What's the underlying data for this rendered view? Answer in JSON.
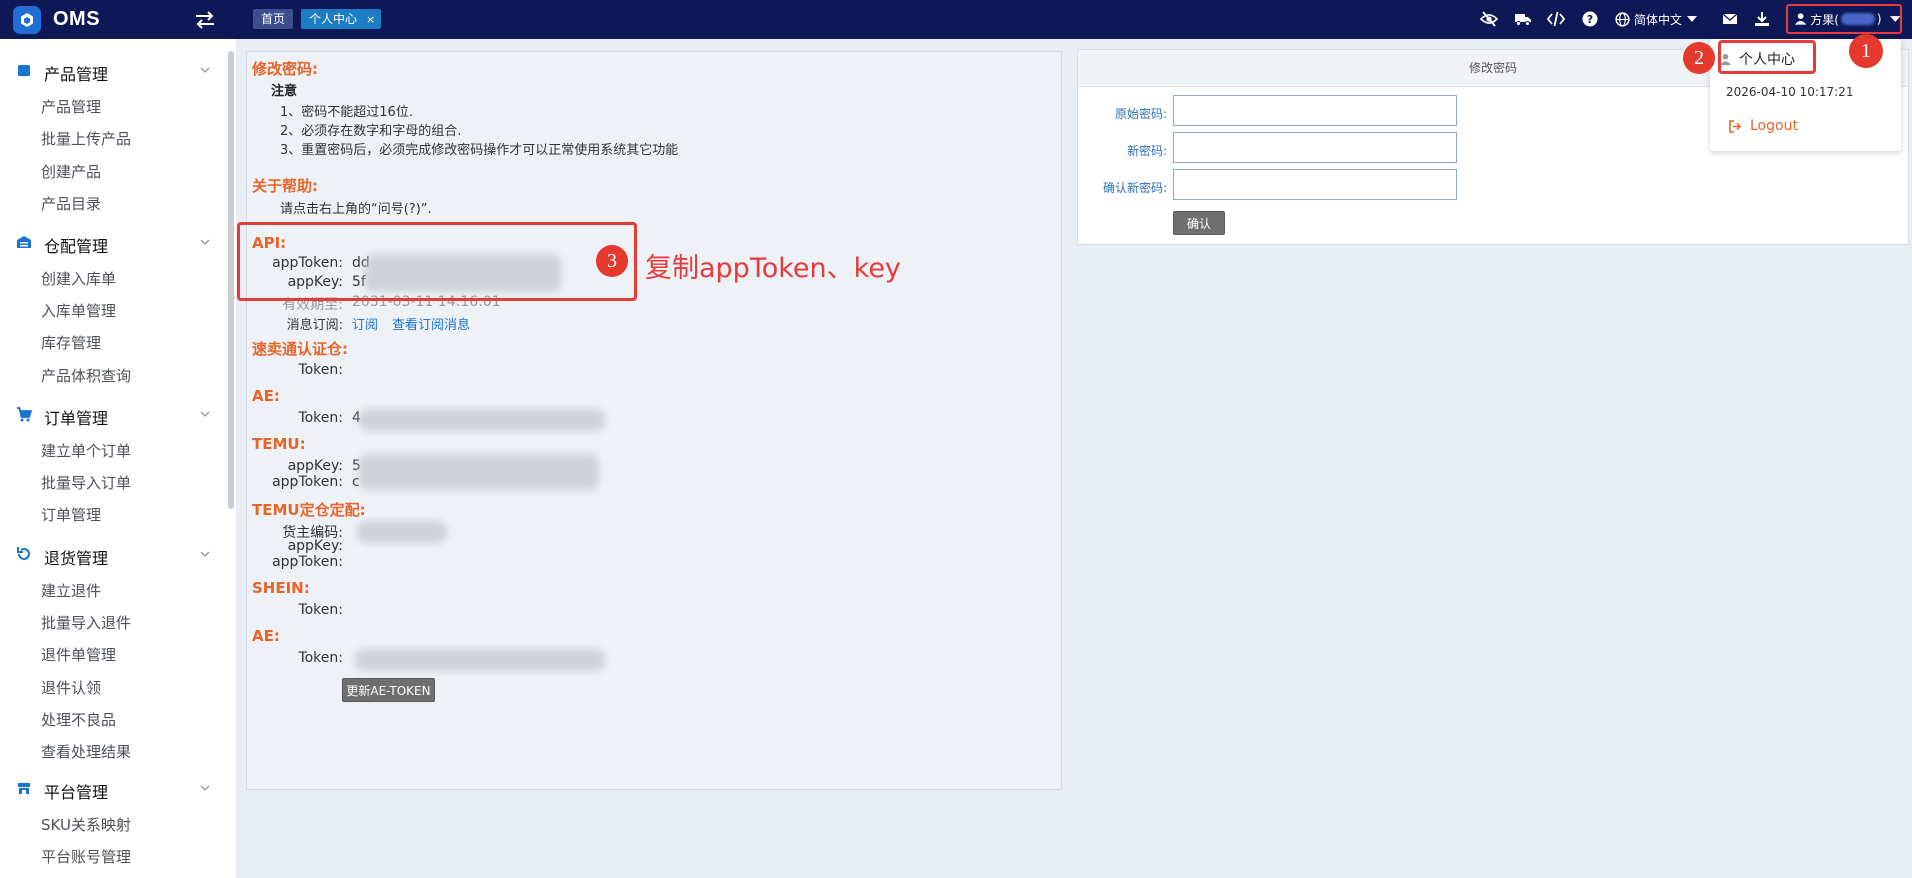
{
  "brand": {
    "name": "OMS"
  },
  "tabs": [
    {
      "label": "首页"
    },
    {
      "label": "个人中心",
      "close": "×"
    }
  ],
  "topbar": {
    "language": "简体中文",
    "user_name": "方果(",
    "user_suffix": ")"
  },
  "sidebar": {
    "categories": [
      {
        "label": "产品管理",
        "icon": "box-icon",
        "items": [
          "产品管理",
          "批量上传产品",
          "创建产品",
          "产品目录"
        ]
      },
      {
        "label": "仓配管理",
        "icon": "warehouse-icon",
        "items": [
          "创建入库单",
          "入库单管理",
          "库存管理",
          "产品体积查询"
        ]
      },
      {
        "label": "订单管理",
        "icon": "cart-icon",
        "items": [
          "建立单个订单",
          "批量导入订单",
          "订单管理"
        ]
      },
      {
        "label": "退货管理",
        "icon": "return-icon",
        "items": [
          "建立退件",
          "批量导入退件",
          "退件单管理",
          "退件认领",
          "处理不良品",
          "查看处理结果"
        ]
      },
      {
        "label": "平台管理",
        "icon": "store-icon",
        "items": [
          "SKU关系映射",
          "平台账号管理"
        ]
      }
    ]
  },
  "info": {
    "password_title": "修改密码:",
    "note_title": "注意",
    "notes": [
      "1、密码不能超过16位.",
      "2、必须存在数字和字母的组合.",
      "3、重置密码后，必须完成修改密码操作才可以正常使用系统其它功能"
    ],
    "help_title": "关于帮助:",
    "help_text": "请点击右上角的“问号(?)”.",
    "api_title": "API:",
    "api_app_token_label": "appToken:",
    "api_app_token_value": "dd",
    "api_app_key_label": "appKey:",
    "api_app_key_value": "5f",
    "api_expire_label": "有效期至:",
    "api_expire_value": "2031-03-11 14:16:01",
    "api_sub_label": "消息订阅:",
    "api_sub_link": "订阅",
    "api_sub_view_link": "查看订阅消息",
    "sutong_title": "速卖通认证仓:",
    "sutong_token_label": "Token:",
    "ae1_title": "AE:",
    "ae1_token_label": "Token:",
    "ae1_token_value": "4",
    "temu_title": "TEMU:",
    "temu_app_key_label": "appKey:",
    "temu_app_key_value": "5",
    "temu_app_token_label": "appToken:",
    "temu_app_token_value": "c",
    "temu2_title": "TEMU定仓定配:",
    "temu2_code_label": "货主编码:",
    "temu2_app_key_label": "appKey:",
    "temu2_app_token_label": "appToken:",
    "shein_title": "SHEIN:",
    "shein_token_label": "Token:",
    "ae2_title": "AE:",
    "ae2_token_label": "Token:",
    "refresh_button": "更新AE-TOKEN"
  },
  "annotations": {
    "step1": "1",
    "step2": "2",
    "step3": "3",
    "copy_text": "复制appToken、key",
    "color": "#e53b3b"
  },
  "change_password": {
    "title": "修改密码",
    "old_label": "原始密码:",
    "new_label": "新密码:",
    "confirm_label": "确认新密码:",
    "submit": "确认"
  },
  "dropdown": {
    "personal_center": "个人中心",
    "timestamp": "2026-04-10 10:17:21",
    "logout": "Logout"
  },
  "colors": {
    "topbar": "#0e1856",
    "accent_orange": "#e8652a",
    "link_blue": "#1a74d2",
    "highlight_red": "#e53b3b"
  }
}
